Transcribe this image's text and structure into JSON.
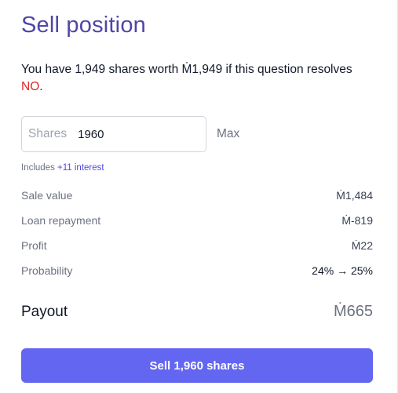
{
  "title": "Sell position",
  "info": {
    "text_before": "You have 1,949 shares worth Ṁ1,949 if this question resolves ",
    "outcome": "NO",
    "text_after": "."
  },
  "shares_input": {
    "prefix": "Shares",
    "value": "1960"
  },
  "max_label": "Max",
  "includes": {
    "text": "Includes ",
    "interest": "+11 interest"
  },
  "rows": {
    "sale_value": {
      "label": "Sale value",
      "value": "Ṁ1,484"
    },
    "loan_repayment": {
      "label": "Loan repayment",
      "value": "Ṁ-819"
    },
    "profit": {
      "label": "Profit",
      "value": "Ṁ22"
    },
    "probability": {
      "label": "Probability",
      "value": "24% → 25%"
    }
  },
  "payout": {
    "label": "Payout",
    "value": "Ṁ665"
  },
  "sell_button": {
    "label": "Sell 1,960 shares"
  },
  "colors": {
    "title": "#4f46a5",
    "no_outcome": "#dc2626",
    "accent": "#6366f1",
    "interest": "#4f46e5"
  }
}
